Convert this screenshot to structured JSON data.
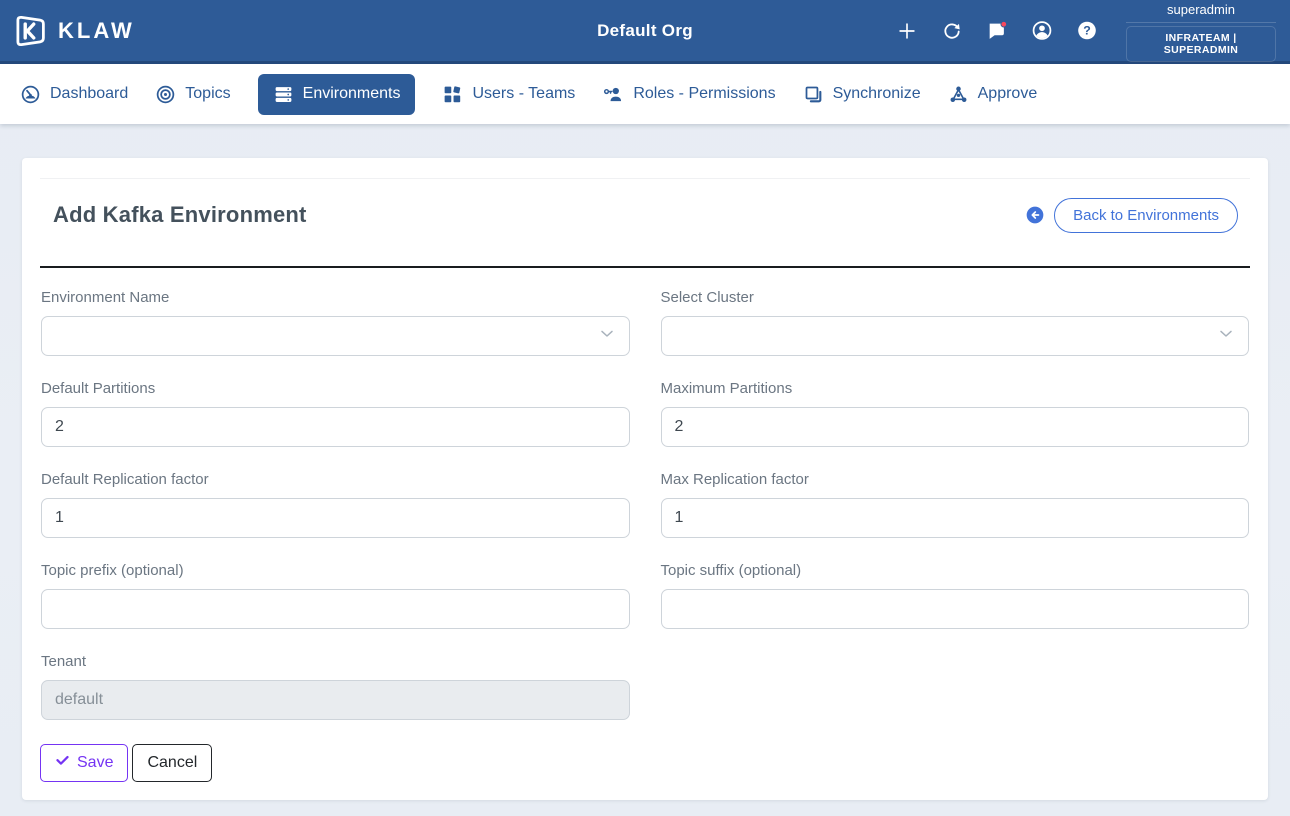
{
  "header": {
    "brand": "KLAW",
    "org_title": "Default Org",
    "username": "superadmin",
    "team_role": "INFRATEAM | SUPERADMIN",
    "icons": [
      "plus-icon",
      "refresh-icon",
      "chat-icon",
      "account-icon",
      "help-icon"
    ],
    "notification_badge_color": "#f8485e",
    "bar_color": "#2e5b97"
  },
  "nav": {
    "items": [
      {
        "label": "Dashboard",
        "icon": "gauge-icon",
        "active": false
      },
      {
        "label": "Topics",
        "icon": "target-icon",
        "active": false
      },
      {
        "label": "Environments",
        "icon": "server-icon",
        "active": true
      },
      {
        "label": "Users - Teams",
        "icon": "widgets-icon",
        "active": false
      },
      {
        "label": "Roles - Permissions",
        "icon": "user-key-icon",
        "active": false
      },
      {
        "label": "Synchronize",
        "icon": "copy-icon",
        "active": false
      },
      {
        "label": "Approve",
        "icon": "hub-icon",
        "active": false
      }
    ],
    "link_color": "#2d5b97"
  },
  "page": {
    "title": "Add Kafka Environment",
    "back_button_label": "Back to Environments",
    "back_accent_color": "#4273d9"
  },
  "form": {
    "fields": {
      "environment_name": {
        "label": "Environment Name",
        "type": "select",
        "value": ""
      },
      "select_cluster": {
        "label": "Select Cluster",
        "type": "select",
        "value": ""
      },
      "default_partitions": {
        "label": "Default Partitions",
        "type": "text",
        "value": "2"
      },
      "maximum_partitions": {
        "label": "Maximum Partitions",
        "type": "text",
        "value": "2"
      },
      "default_replication_factor": {
        "label": "Default Replication factor",
        "type": "text",
        "value": "1"
      },
      "max_replication_factor": {
        "label": "Max Replication factor",
        "type": "text",
        "value": "1"
      },
      "topic_prefix": {
        "label": "Topic prefix (optional)",
        "type": "text",
        "value": ""
      },
      "topic_suffix": {
        "label": "Topic suffix (optional)",
        "type": "text",
        "value": ""
      },
      "tenant": {
        "label": "Tenant",
        "type": "text",
        "value": "default",
        "disabled": true
      }
    },
    "buttons": {
      "save": "Save",
      "cancel": "Cancel",
      "save_color": "#7534f3"
    }
  }
}
